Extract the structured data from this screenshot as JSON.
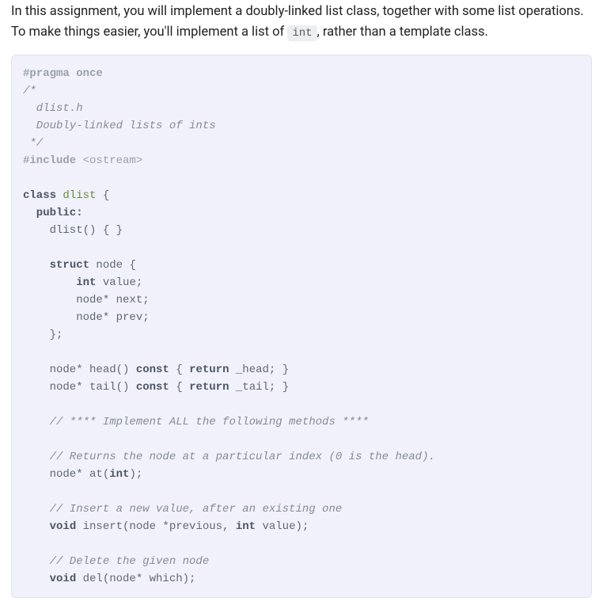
{
  "intro": {
    "prefix": "In this assignment, you will implement a doubly-linked list class, together with some list operations. To make things easier, you'll implement a list of ",
    "code": "int",
    "suffix": ", rather than a template class."
  },
  "code": {
    "l01": "#pragma once",
    "l02": "/*",
    "l03": "  dlist.h",
    "l04": "  Doubly-linked lists of ints",
    "l05": " */",
    "l06a": "#include",
    "l06b": " <ostream>",
    "l07": "",
    "l08a": "class",
    "l08b": " dlist",
    "l08c": " {",
    "l09": "  public:",
    "l10a": "    dlist() { }",
    "l11": "",
    "l12a": "    ",
    "l12b": "struct",
    "l12c": " node {",
    "l13a": "        ",
    "l13b": "int",
    "l13c": " value;",
    "l14": "        node* next;",
    "l15": "        node* prev;",
    "l16": "    };",
    "l17": "",
    "l18a": "    node* head() ",
    "l18b": "const",
    "l18c": " { ",
    "l18d": "return",
    "l18e": " _head; }",
    "l19a": "    node* tail() ",
    "l19b": "const",
    "l19c": " { ",
    "l19d": "return",
    "l19e": " _tail; }",
    "l20": "",
    "l21": "    // **** Implement ALL the following methods ****",
    "l22": "",
    "l23": "    // Returns the node at a particular index (0 is the head).",
    "l24a": "    node* at(",
    "l24b": "int",
    "l24c": ");",
    "l25": "",
    "l26": "    // Insert a new value, after an existing one",
    "l27a": "    ",
    "l27b": "void",
    "l27c": " insert(node *previous, ",
    "l27d": "int",
    "l27e": " value);",
    "l28": "",
    "l29": "    // Delete the given node",
    "l30a": "    ",
    "l30b": "void",
    "l30c": " del(node* which);"
  }
}
